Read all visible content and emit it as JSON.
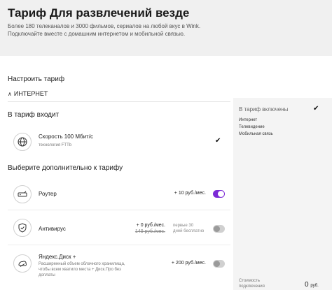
{
  "hero": {
    "title": "Тариф Для развлечений везде",
    "subtitle": "Более 180 телеканалов и 3000 фильмов, сериалов на любой вкус в Wink. Подключайте вместе с домашним интернетом и мобильной связью."
  },
  "config": {
    "heading": "Настроить тариф",
    "section_label": "ИНТЕРНЕТ",
    "included_heading": "В тариф входит",
    "extra_heading": "Выберите дополнительно к тарифу"
  },
  "included": [
    {
      "icon": "globe-icon",
      "title": "Скорость 100 Мбит/с",
      "desc": "технология FTTb",
      "checked": true
    }
  ],
  "extras": [
    {
      "icon": "router-icon",
      "title": "Роутер",
      "desc": "",
      "price": "+ 10 руб./мес.",
      "price_old": "",
      "promo": "",
      "enabled": true
    },
    {
      "icon": "shield-icon",
      "title": "Антивирус",
      "desc": "",
      "price": "+ 0 руб./мес.",
      "price_old": "149 руб./мес.",
      "promo": "первые 30\nдней бесплатно",
      "enabled": false
    },
    {
      "icon": "cloud-disk-icon",
      "title": "Яндекс.Диск +",
      "desc": "Расширенный объем облачного хранилища,\nчтобы всем хватило места + Диск.Про без\nдоплаты",
      "price": "+ 200 руб./мес.",
      "price_old": "",
      "promo": "",
      "enabled": false
    }
  ],
  "summary": {
    "title": "В тариф включены",
    "items": [
      "Интернет",
      "Телевидение",
      "Мобильная связь"
    ],
    "cost_label": "Стоимость\nподключения",
    "cost_value": "0",
    "cost_unit": "руб."
  },
  "colors": {
    "accent": "#7c2bd6",
    "hero_bg": "#f0f0f0",
    "summary_bg": "#f4f4f4"
  }
}
